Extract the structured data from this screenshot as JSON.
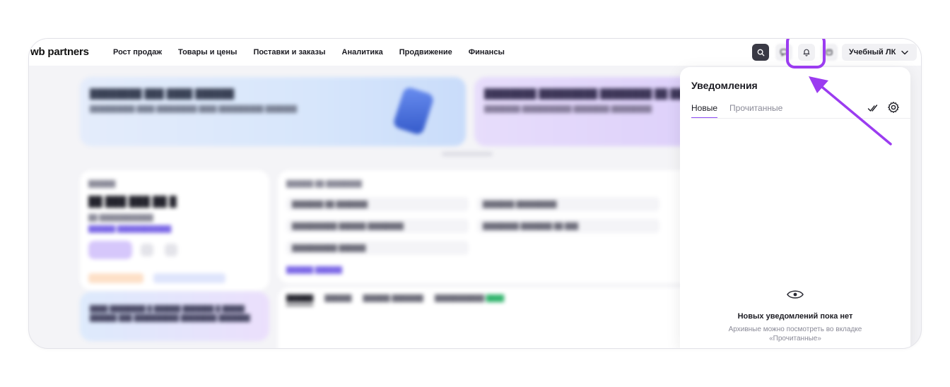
{
  "logo": {
    "prefix": "wb",
    "name": "partners"
  },
  "nav": {
    "items": [
      "Рост продаж",
      "Товары и цены",
      "Поставки и заказы",
      "Аналитика",
      "Продвижение",
      "Финансы"
    ]
  },
  "toolbar": {
    "search_icon": "search-icon",
    "chat_icon": "chat-icon",
    "bell_icon": "bell-icon",
    "message_icon": "message-icon",
    "account_label": "Учебный ЛК",
    "account_chevron": "chevron-down-icon"
  },
  "notifications": {
    "title": "Уведомления",
    "tabs": [
      "Новые",
      "Прочитанные"
    ],
    "active_tab": "Новые",
    "mark_all_read_icon": "double-check-icon",
    "settings_icon": "gear-icon",
    "empty_icon": "eye-icon",
    "empty_title": "Новых уведомлений пока нет",
    "empty_subtitle": "Архивные можно посмотреть во вкладке «Прочитанные»"
  },
  "colors": {
    "highlight": "#9b3cf0",
    "accent_tab": "#8f4ef5",
    "search_button": "#3a3a45"
  },
  "annotation": {
    "highlight_target": "bell-icon",
    "arrow_icon": "arrow-pointer-icon"
  }
}
